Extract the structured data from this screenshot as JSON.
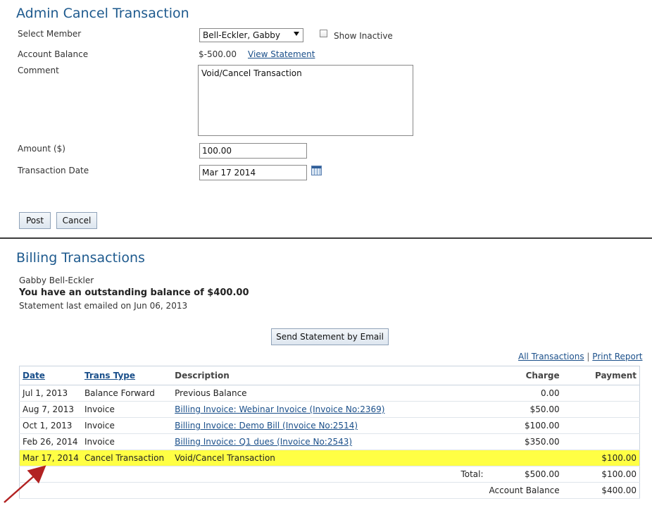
{
  "form": {
    "title": "Admin Cancel Transaction",
    "select_member_label": "Select Member",
    "member_selected": "Bell-Eckler, Gabby",
    "show_inactive_label": "Show Inactive",
    "account_balance_label": "Account Balance",
    "account_balance_value": "$-500.00",
    "view_statement_link": "View Statement",
    "comment_label": "Comment",
    "comment_value": "Void/Cancel Transaction",
    "amount_label": "Amount ($)",
    "amount_value": "100.00",
    "date_label": "Transaction Date",
    "date_value": "Mar 17 2014",
    "post_button": "Post",
    "cancel_button": "Cancel"
  },
  "billing": {
    "title": "Billing Transactions",
    "member_name": "Gabby Bell-Eckler",
    "outstanding": "You have an outstanding balance of $400.00",
    "last_emailed": "Statement last emailed on Jun 06, 2013",
    "send_email_button": "Send Statement by Email",
    "all_transactions_link": "All Transactions",
    "separator": "|",
    "print_report_link": "Print Report",
    "columns": {
      "date": "Date",
      "type": "Trans Type",
      "description": "Description",
      "charge": "Charge",
      "payment": "Payment"
    },
    "rows": [
      {
        "date": "Jul 1, 2013",
        "type": "Balance Forward",
        "description": "Previous Balance",
        "charge": "0.00",
        "payment": ""
      },
      {
        "date": "Aug 7, 2013",
        "type": "Invoice",
        "description": "Billing Invoice: Webinar Invoice (Invoice No:2369)",
        "charge": "$50.00",
        "payment": ""
      },
      {
        "date": "Oct 1, 2013",
        "type": "Invoice",
        "description": "Billing Invoice: Demo Bill (Invoice No:2514)",
        "charge": "$100.00",
        "payment": ""
      },
      {
        "date": "Feb 26, 2014",
        "type": "Invoice",
        "description": "Billing Invoice: Q1 dues (Invoice No:2543)",
        "charge": "$350.00",
        "payment": ""
      },
      {
        "date": "Mar 17, 2014",
        "type": "Cancel Transaction",
        "description": "Void/Cancel Transaction",
        "charge": "",
        "payment": "$100.00"
      }
    ],
    "total_label": "Total:",
    "total_charge": "$500.00",
    "total_payment": "$100.00",
    "balance_label": "Account Balance",
    "balance_value": "$400.00"
  },
  "colors": {
    "highlight": "#ffff44",
    "heading": "#1e5a8e",
    "arrow": "#b22222"
  }
}
